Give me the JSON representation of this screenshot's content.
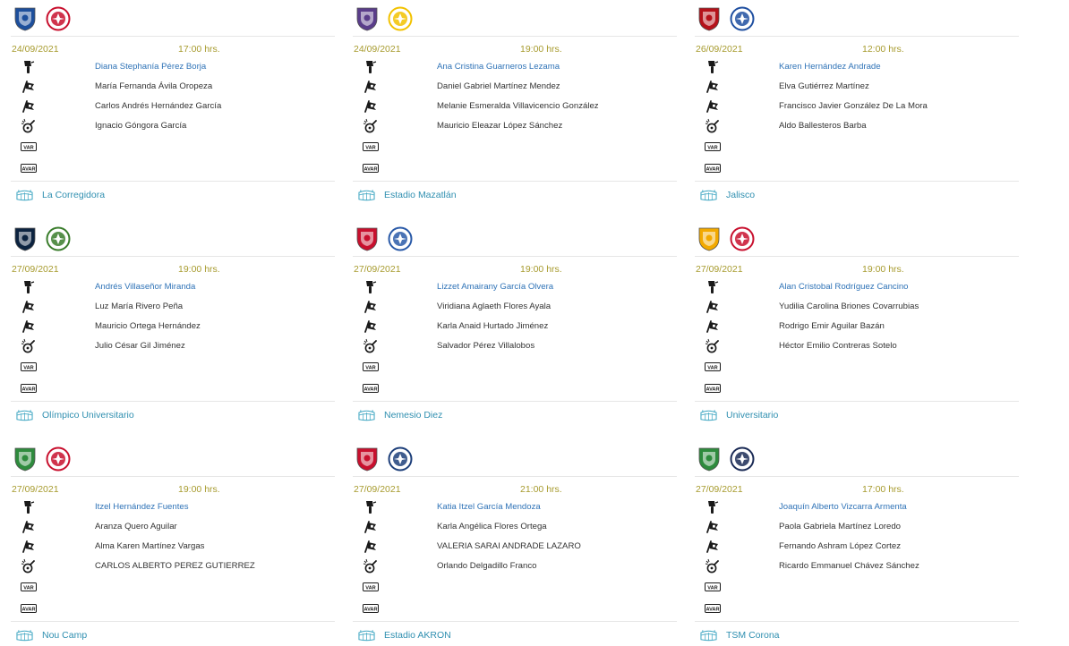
{
  "colors": {
    "accent_text": "#2f8fb0",
    "link": "#2f73b7",
    "date": "#a79b2e",
    "divider": "#e6e6e6",
    "icon": "#1a1a1a",
    "venue_icon": "#45a9c4"
  },
  "role_icons": [
    "referee-icon",
    "assistant-flag-icon",
    "assistant-flag-icon",
    "fourth-official-icon",
    "var-icon",
    "avar-icon"
  ],
  "badges": {
    "var": "VAR",
    "avar": "AVAR"
  },
  "venue_icon": "stadium-icon",
  "matches": [
    {
      "home_logo": "queretaro-crest-icon",
      "away_logo": "atletico-san-luis-crest-icon",
      "home_color": "#1d4f9c",
      "away_color": "#c8102e",
      "date": "24/09/2021",
      "time": "17:00 hrs.",
      "referee": "Diana Stephanía Pérez Borja",
      "assistant_1": "María Fernanda Ávila Oropeza",
      "assistant_2": "Carlos Andrés Hernández García",
      "fourth": "Ignacio Góngora García",
      "var": "",
      "avar": "",
      "venue": "La Corregidora"
    },
    {
      "home_logo": "mazatlan-crest-icon",
      "away_logo": "america-crest-icon",
      "home_color": "#5a3d8a",
      "away_color": "#f2c200",
      "date": "24/09/2021",
      "time": "19:00 hrs.",
      "referee": "Ana Cristina Guarneros Lezama",
      "assistant_1": "Daniel Gabriel Martínez Mendez",
      "assistant_2": "Melanie Esmeralda Villavicencio González",
      "fourth": "Mauricio Eleazar López Sánchez",
      "var": "",
      "avar": "",
      "venue": "Estadio Mazatlán"
    },
    {
      "home_logo": "atlas-crest-icon",
      "away_logo": "cruz-azul-crest-icon",
      "home_color": "#b5121b",
      "away_color": "#1f4fa0",
      "date": "26/09/2021",
      "time": "12:00 hrs.",
      "referee": "Karen Hernández Andrade",
      "assistant_1": "Elva Gutiérrez Martínez",
      "assistant_2": "Francisco Javier González De La Mora",
      "fourth": "Aldo Ballesteros Barba",
      "var": "",
      "avar": "",
      "venue": "Jalisco"
    },
    {
      "home_logo": "pumas-crest-icon",
      "away_logo": "juarez-crest-icon",
      "home_color": "#0c2340",
      "away_color": "#3a7d2c",
      "date": "27/09/2021",
      "time": "19:00 hrs.",
      "referee": "Andrés Villaseñor Miranda",
      "assistant_1": "Luz María Rivero Peña",
      "assistant_2": "Mauricio Ortega Hernández",
      "fourth": "Julio César Gil Jiménez",
      "var": "",
      "avar": "",
      "venue": "Olímpico Universitario"
    },
    {
      "home_logo": "toluca-crest-icon",
      "away_logo": "puebla-crest-icon",
      "home_color": "#c8102e",
      "away_color": "#2a5aa8",
      "date": "27/09/2021",
      "time": "19:00 hrs.",
      "referee": "Lizzet Amairany García Olvera",
      "assistant_1": "Viridiana Aglaeth Flores Ayala",
      "assistant_2": "Karla Anaid Hurtado Jiménez",
      "fourth": "Salvador Pérez Villalobos",
      "var": "",
      "avar": "",
      "venue": "Nemesio Diez"
    },
    {
      "home_logo": "tigres-crest-icon",
      "away_logo": "tijuana-crest-icon",
      "home_color": "#f2a900",
      "away_color": "#c8102e",
      "date": "27/09/2021",
      "time": "19:00 hrs.",
      "referee": "Alan Cristobal Rodríguez Cancino",
      "assistant_1": "Yudilia Carolina Briones Covarrubias",
      "assistant_2": "Rodrigo Emir Aguilar Bazán",
      "fourth": "Héctor Emilio Contreras Sotelo",
      "var": "",
      "avar": "",
      "venue": "Universitario"
    },
    {
      "home_logo": "leon-crest-icon",
      "away_logo": "necaxa-crest-icon",
      "home_color": "#2e8b3d",
      "away_color": "#c8102e",
      "date": "27/09/2021",
      "time": "19:00 hrs.",
      "referee": "Itzel Hernández Fuentes",
      "assistant_1": "Aranza Quero Aguilar",
      "assistant_2": "Alma Karen Martínez Vargas",
      "fourth": "CARLOS ALBERTO PEREZ GUTIERREZ",
      "var": "",
      "avar": "",
      "venue": "Nou Camp"
    },
    {
      "home_logo": "chivas-crest-icon",
      "away_logo": "pachuca-crest-icon",
      "home_color": "#c8102e",
      "away_color": "#1d3f7a",
      "date": "27/09/2021",
      "time": "21:00 hrs.",
      "referee": "Katia Itzel García Mendoza",
      "assistant_1": "Karla Angélica Flores Ortega",
      "assistant_2": "VALERIA SARAI ANDRADE LAZARO",
      "fourth": "Orlando Delgadillo Franco",
      "var": "",
      "avar": "",
      "venue": "Estadio AKRON"
    },
    {
      "home_logo": "santos-crest-icon",
      "away_logo": "monterrey-crest-icon",
      "home_color": "#2e8b3d",
      "away_color": "#1a2a55",
      "date": "27/09/2021",
      "time": "17:00 hrs.",
      "referee": "Joaquín Alberto Vizcarra Armenta",
      "assistant_1": "Paola Gabriela Martínez Loredo",
      "assistant_2": "Fernando Ashram López Cortez",
      "fourth": "Ricardo Emmanuel Chávez Sánchez",
      "var": "",
      "avar": "",
      "venue": "TSM Corona"
    }
  ]
}
